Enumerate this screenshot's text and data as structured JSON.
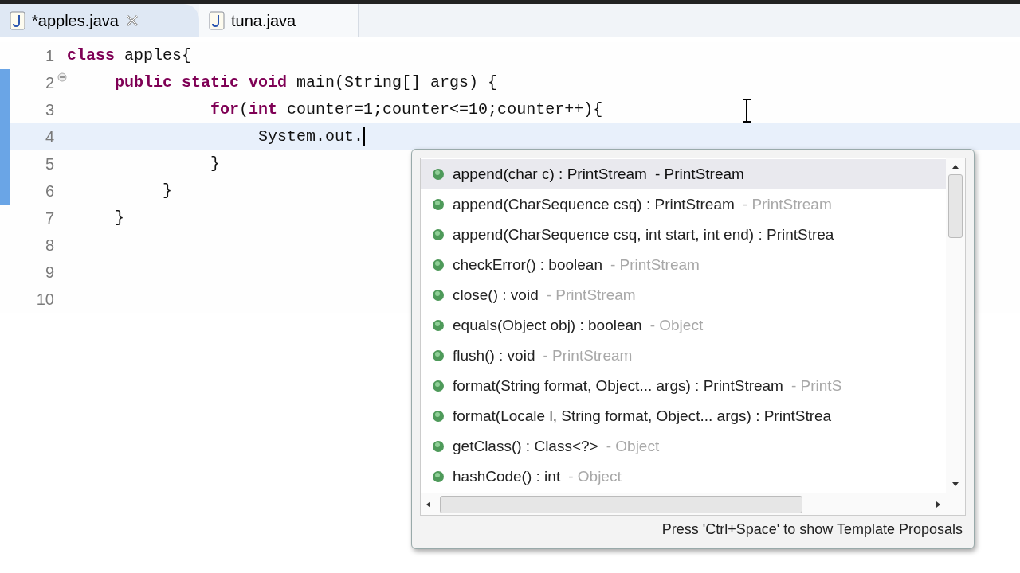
{
  "tabs": [
    {
      "label": "*apples.java",
      "selected": true,
      "closable": true
    },
    {
      "label": "tuna.java",
      "selected": false,
      "closable": false
    }
  ],
  "editor": {
    "lines": [
      {
        "number": "1",
        "current": false,
        "changed": false,
        "foldable": false,
        "tokens": [
          {
            "kind": "keyword",
            "text": "class"
          },
          {
            "kind": "plain",
            "text": " apples{"
          }
        ]
      },
      {
        "number": "2",
        "current": false,
        "changed": true,
        "foldable": true,
        "tokens": [
          {
            "kind": "keyword",
            "text": "     public static void"
          },
          {
            "kind": "plain",
            "text": " main(String[] args) {"
          }
        ]
      },
      {
        "number": "3",
        "current": false,
        "changed": true,
        "foldable": false,
        "tokens": [
          {
            "kind": "keyword",
            "text": "               for"
          },
          {
            "kind": "plain",
            "text": "("
          },
          {
            "kind": "keyword",
            "text": "int"
          },
          {
            "kind": "plain",
            "text": " counter=1;counter<=10;counter++){"
          }
        ]
      },
      {
        "number": "4",
        "current": true,
        "changed": true,
        "foldable": false,
        "tokens": [
          {
            "kind": "plain",
            "text": "                    System.out."
          }
        ]
      },
      {
        "number": "5",
        "current": false,
        "changed": true,
        "foldable": false,
        "tokens": [
          {
            "kind": "plain",
            "text": "               }"
          }
        ]
      },
      {
        "number": "6",
        "current": false,
        "changed": true,
        "foldable": false,
        "tokens": [
          {
            "kind": "plain",
            "text": "          }"
          }
        ]
      },
      {
        "number": "7",
        "current": false,
        "changed": false,
        "foldable": false,
        "tokens": [
          {
            "kind": "plain",
            "text": "     }"
          }
        ]
      },
      {
        "number": "8",
        "current": false,
        "changed": false,
        "foldable": false
      },
      {
        "number": "9",
        "current": false,
        "changed": false,
        "foldable": false
      },
      {
        "number": "10",
        "current": false,
        "changed": false,
        "foldable": false
      }
    ]
  },
  "completion": {
    "items": [
      {
        "label": "append(char c) : PrintStream",
        "owner": "- PrintStream",
        "selected": true
      },
      {
        "label": "append(CharSequence csq) : PrintStream",
        "owner": "- PrintStream",
        "selected": false
      },
      {
        "label": "append(CharSequence csq, int start, int end) : PrintStrea",
        "selected": false
      },
      {
        "label": "checkError() : boolean",
        "owner": "- PrintStream",
        "selected": false
      },
      {
        "label": "close() : void",
        "owner": "- PrintStream",
        "selected": false
      },
      {
        "label": "equals(Object obj) : boolean",
        "owner": "- Object",
        "selected": false
      },
      {
        "label": "flush() : void",
        "owner": "- PrintStream",
        "selected": false
      },
      {
        "label": "format(String format, Object... args) : PrintStream",
        "owner": "- PrintS",
        "selected": false
      },
      {
        "label": "format(Locale l, String format, Object... args) : PrintStrea",
        "selected": false
      },
      {
        "label": "getClass() : Class<?>",
        "owner": "- Object",
        "selected": false
      },
      {
        "label": "hashCode() : int",
        "owner": "- Object",
        "selected": false
      }
    ],
    "hint": "Press 'Ctrl+Space' to show Template Proposals"
  }
}
